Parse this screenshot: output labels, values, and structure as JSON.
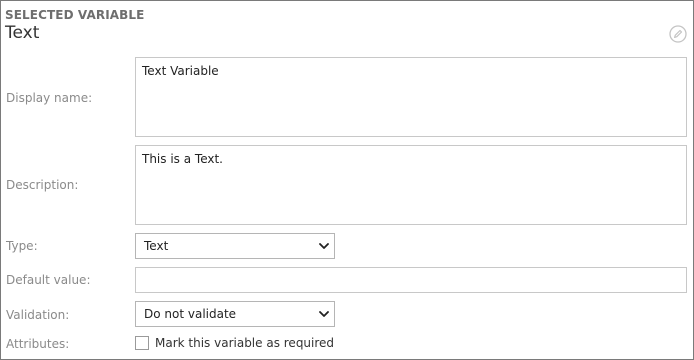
{
  "header": {
    "section_label": "SELECTED VARIABLE",
    "variable_title": "Text",
    "edit_icon": "edit-pencil-icon"
  },
  "form": {
    "display_name": {
      "label": "Display name:",
      "value": "Text Variable"
    },
    "description": {
      "label": "Description:",
      "value": "This is a Text."
    },
    "type": {
      "label": "Type:",
      "selected": "Text"
    },
    "default_value": {
      "label": "Default value:",
      "value": ""
    },
    "validation": {
      "label": "Validation:",
      "selected": "Do not validate"
    },
    "attributes": {
      "label": "Attributes:",
      "checkbox_label": "Mark this variable as required",
      "checked": false
    }
  },
  "colors": {
    "border": "#c8c8c8",
    "label_text": "#8a8a8a",
    "heading_text": "#6e6e6e"
  }
}
